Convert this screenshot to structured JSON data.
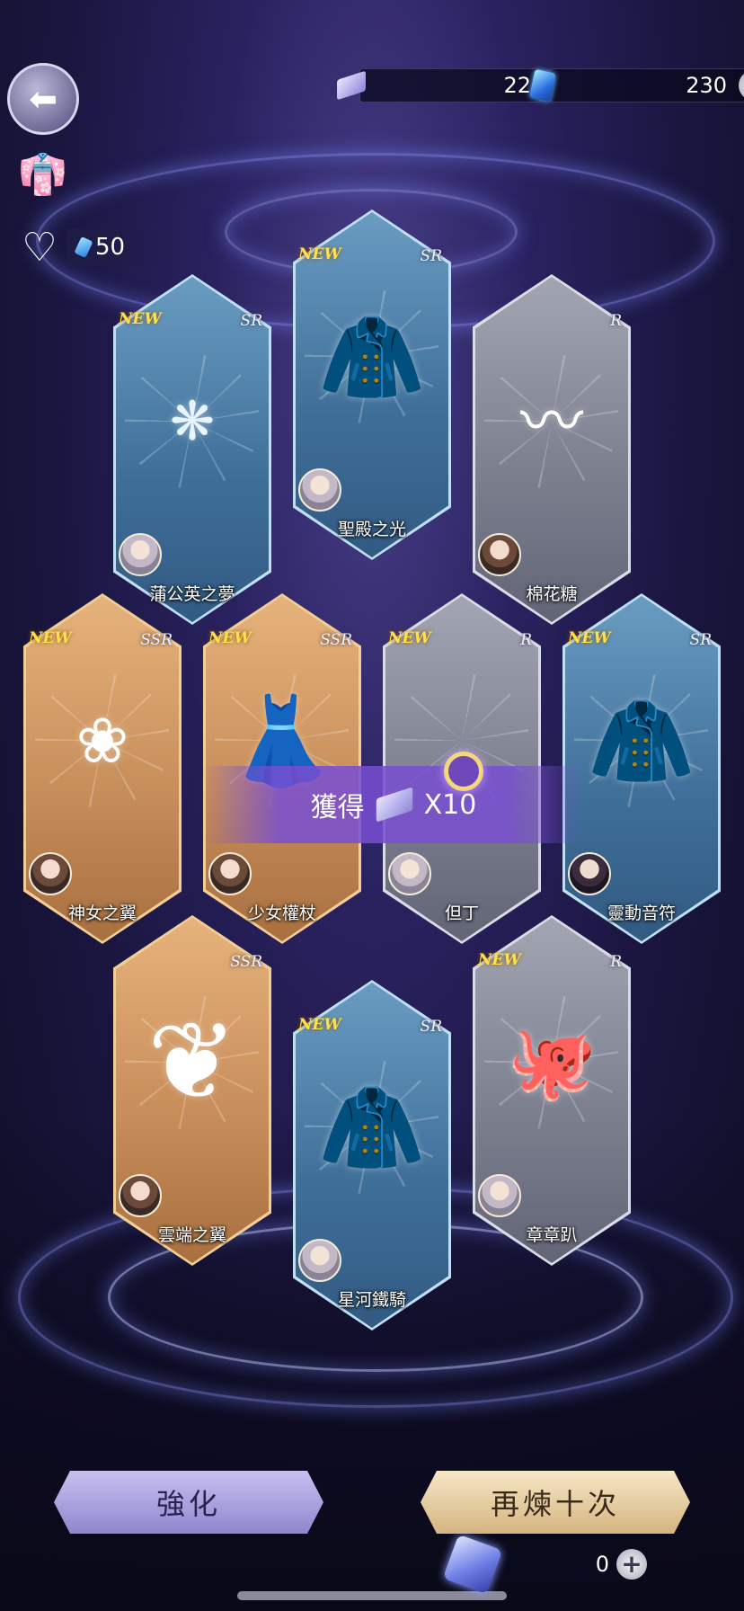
{
  "currency": {
    "tickets": "22",
    "gems": "230"
  },
  "hearts": {
    "value": "50"
  },
  "cards": [
    {
      "name": "蒲公英之夢",
      "rarity": "SR",
      "new": "NEW",
      "item": "❋"
    },
    {
      "name": "聖殿之光",
      "rarity": "SR",
      "new": "NEW",
      "item": "🧥"
    },
    {
      "name": "棉花糖",
      "rarity": "R",
      "new": "",
      "item": "〰"
    },
    {
      "name": "神女之翼",
      "rarity": "SSR",
      "new": "NEW",
      "item": "❀"
    },
    {
      "name": "少女權杖",
      "rarity": "SSR",
      "new": "NEW",
      "item": "👗"
    },
    {
      "name": "但丁",
      "rarity": "R",
      "new": "NEW",
      "item": ""
    },
    {
      "name": "靈動音符",
      "rarity": "SR",
      "new": "NEW",
      "item": "🧥"
    },
    {
      "name": "雲端之翼",
      "rarity": "SSR",
      "new": "",
      "item": "❦"
    },
    {
      "name": "星河鐵騎",
      "rarity": "SR",
      "new": "NEW",
      "item": "🧥"
    },
    {
      "name": "章章趴",
      "rarity": "R",
      "new": "NEW",
      "item": "🐙"
    }
  ],
  "banner": {
    "label": "獲得",
    "count": "X10"
  },
  "buttons": {
    "enhance": "強化",
    "refine_ten": "再煉十次"
  },
  "cost": {
    "value": "0"
  },
  "colors": {
    "ssr": "#e6b27c",
    "sr": "#6a9cc2",
    "r": "#a2a5b2",
    "new": "#ffe04a",
    "banner": "#784ed2"
  }
}
